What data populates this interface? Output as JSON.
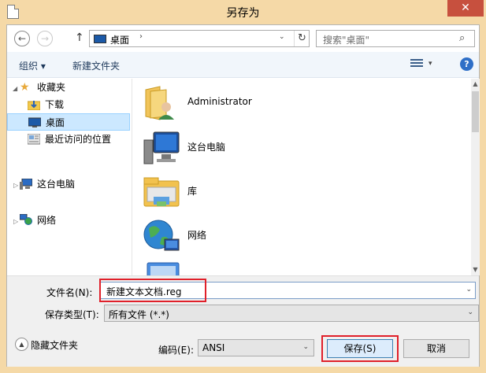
{
  "window": {
    "title": "另存为",
    "close_glyph": "✕",
    "frame_color": "#f5d9a7",
    "close_color": "#c7503e"
  },
  "address_bar": {
    "back_glyph": "←",
    "forward_glyph": "→",
    "up_glyph": "↑",
    "crumb": "桌面",
    "crumb_arrow": "›",
    "dropdown_glyph": "⌄",
    "refresh_glyph": "↻",
    "search_placeholder": "搜索\"桌面\"",
    "search_glyph": "⌕"
  },
  "toolbar": {
    "organize": "组织 ▾",
    "new_folder": "新建文件夹",
    "view_drop": "▾",
    "help": "?"
  },
  "nav": {
    "items": [
      {
        "label": "收藏夹",
        "icon": "star-icon",
        "expander": "◢"
      },
      {
        "label": "下载",
        "icon": "download-folder-icon"
      },
      {
        "label": "桌面",
        "icon": "desktop-icon",
        "selected": true
      },
      {
        "label": "最近访问的位置",
        "icon": "recent-places-icon"
      },
      {
        "label": "这台电脑",
        "icon": "computer-icon",
        "expander": "▷"
      },
      {
        "label": "网络",
        "icon": "network-icon",
        "expander": "▷"
      }
    ]
  },
  "files": [
    {
      "name": "Administrator",
      "icon": "user-folder-icon"
    },
    {
      "name": "这台电脑",
      "icon": "computer-icon"
    },
    {
      "name": "库",
      "icon": "library-icon"
    },
    {
      "name": "网络",
      "icon": "network-icon"
    }
  ],
  "scrollbar": {
    "up": "▲",
    "down": "▼"
  },
  "form": {
    "filename_label": "文件名(N):",
    "filename_value": "新建文本文档.reg",
    "filetype_label": "保存类型(T):",
    "filetype_value": "所有文件 (*.*)",
    "hide_folders": "隐藏文件夹",
    "hide_glyph": "▲",
    "encoding_label": "编码(E):",
    "encoding_value": "ANSI",
    "save": "保存(S)",
    "cancel": "取消",
    "dropdown_glyph": "⌄"
  }
}
